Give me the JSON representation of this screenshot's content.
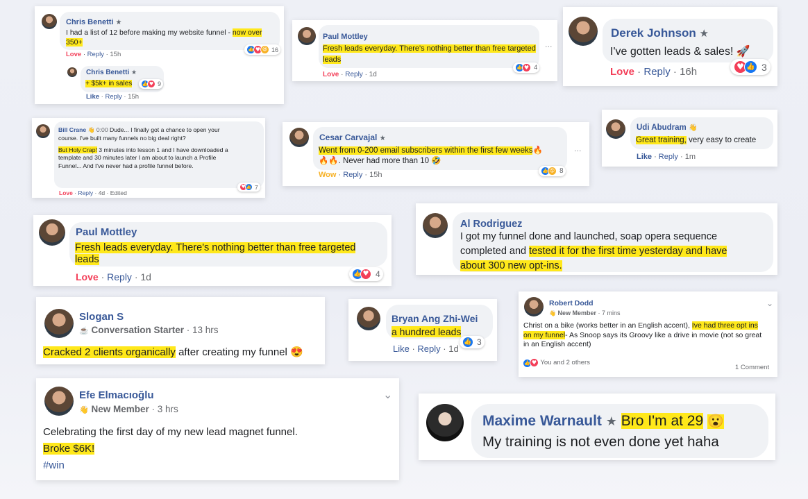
{
  "icons": {
    "star": "★",
    "like": "👍",
    "love": "♥",
    "haha": "😆",
    "wow": "😮",
    "fire": "🔥",
    "heart_eyes": "😍",
    "rocket": "🚀",
    "laugh": "🤣",
    "coffee": "☕",
    "wave": "👋",
    "dots": "···",
    "chevron": "⌄"
  },
  "colors": {
    "name_blue": "#385898",
    "highlight": "#ffe81a",
    "love_red": "#f33e58",
    "like_blue": "#1877f2",
    "wow_orange": "#f7b125",
    "meta_gray": "#65676b",
    "bubble_gray": "#f0f2f5"
  },
  "comments": {
    "c1": {
      "name": "Chris Benetti",
      "text_a": "I had a list of 12 before making my website funnel - ",
      "text_hl1": "now over",
      "text_hl2": "350+",
      "reaction_word": "Love",
      "reply": "Reply",
      "time": "15h",
      "count": "16",
      "reply_name": "Chris Benetti",
      "reply_text": "+ $5k+ in sales",
      "reply_count": "9",
      "reply_like": "Like",
      "reply_reply": "Reply",
      "reply_time": "15h"
    },
    "c2": {
      "name": "Paul Mottley",
      "text_hl1": "Fresh leads everyday. There's nothing better than free targeted",
      "text_hl2": "leads",
      "reaction_word": "Love",
      "reply": "Reply",
      "time": "1d",
      "count": "4"
    },
    "c3": {
      "name": "Derek Johnson",
      "text": "I've gotten leads & sales!",
      "reaction_word": "Love",
      "reply": "Reply",
      "time": "16h",
      "count": "3"
    },
    "c4": {
      "name": "Bill Crane",
      "video_time": "0:00",
      "line1": "Dude... I finally got a chance to open your",
      "line2": "course. I've built many funnels no big deal right?",
      "hl": "But Holy Crap!",
      "line3": " 3 minutes into lesson 1 and I have downloaded a",
      "line4": "template and 30 minutes later I am about to launch a Profile",
      "line5": "Funnel... And I've never had a profile funnel before.",
      "reaction_word": "Love",
      "reply": "Reply",
      "time": "4d",
      "edited": "Edited",
      "count": "7"
    },
    "c5": {
      "name": "Cesar Carvajal",
      "hl": "Went from 0-200 email subscribers within the first few weeks",
      "line2": ". Never had more than 10",
      "reaction_word": "Wow",
      "reply": "Reply",
      "time": "15h",
      "count": "8"
    },
    "c6": {
      "name": "Udi Abudram",
      "hl": "Great training,",
      "text": " very easy to create",
      "like": "Like",
      "reply": "Reply",
      "time": "1m"
    },
    "c7": {
      "name": "Paul Mottley",
      "text_hl1": "Fresh leads everyday. There's nothing better than free targeted",
      "text_hl2": "leads",
      "reaction_word": "Love",
      "reply": "Reply",
      "time": "1d",
      "count": "4"
    },
    "c8": {
      "name": "Al Rodriguez",
      "line1": "I got my funnel done and launched, soap opera sequence",
      "line2a": "completed and ",
      "line2hl": "tested it for the first time yesterday and have",
      "line3hl": "about 300 new opt-ins."
    },
    "c9": {
      "name": "Slogan S",
      "badge": "Conversation Starter",
      "time": "13 hrs",
      "hl": "Cracked 2 clients organically",
      "text": " after creating my funnel"
    },
    "c10": {
      "name": "Bryan Ang Zhi-Wei",
      "hl": "a hundred leads",
      "like": "Like",
      "reply": "Reply",
      "time": "1d",
      "count": "3"
    },
    "c11": {
      "name": "Robert Dodd",
      "badge": "New Member",
      "time": "7 mins",
      "line1a": "Christ on a bike (works better in an English accent), ",
      "line1hl": "Ive had three opt ins",
      "line2": "on my funnel",
      "line2b": "- As Snoop says its Groovy like a drive in movie (not so great",
      "line3": "in an English accent)",
      "reactors": "You and 2 others",
      "comments": "1 Comment"
    },
    "c12": {
      "name": "Efe Elmacıoğlu",
      "badge": "New Member",
      "time": "3 hrs",
      "text": "Celebrating the first day of my new lead magnet funnel.",
      "hl": "Broke $6K!",
      "tag": "#win"
    },
    "c13": {
      "name": "Maxime Warnault",
      "hl": "Bro I'm at 29",
      "line2": "My training is not even done yet haha"
    }
  }
}
